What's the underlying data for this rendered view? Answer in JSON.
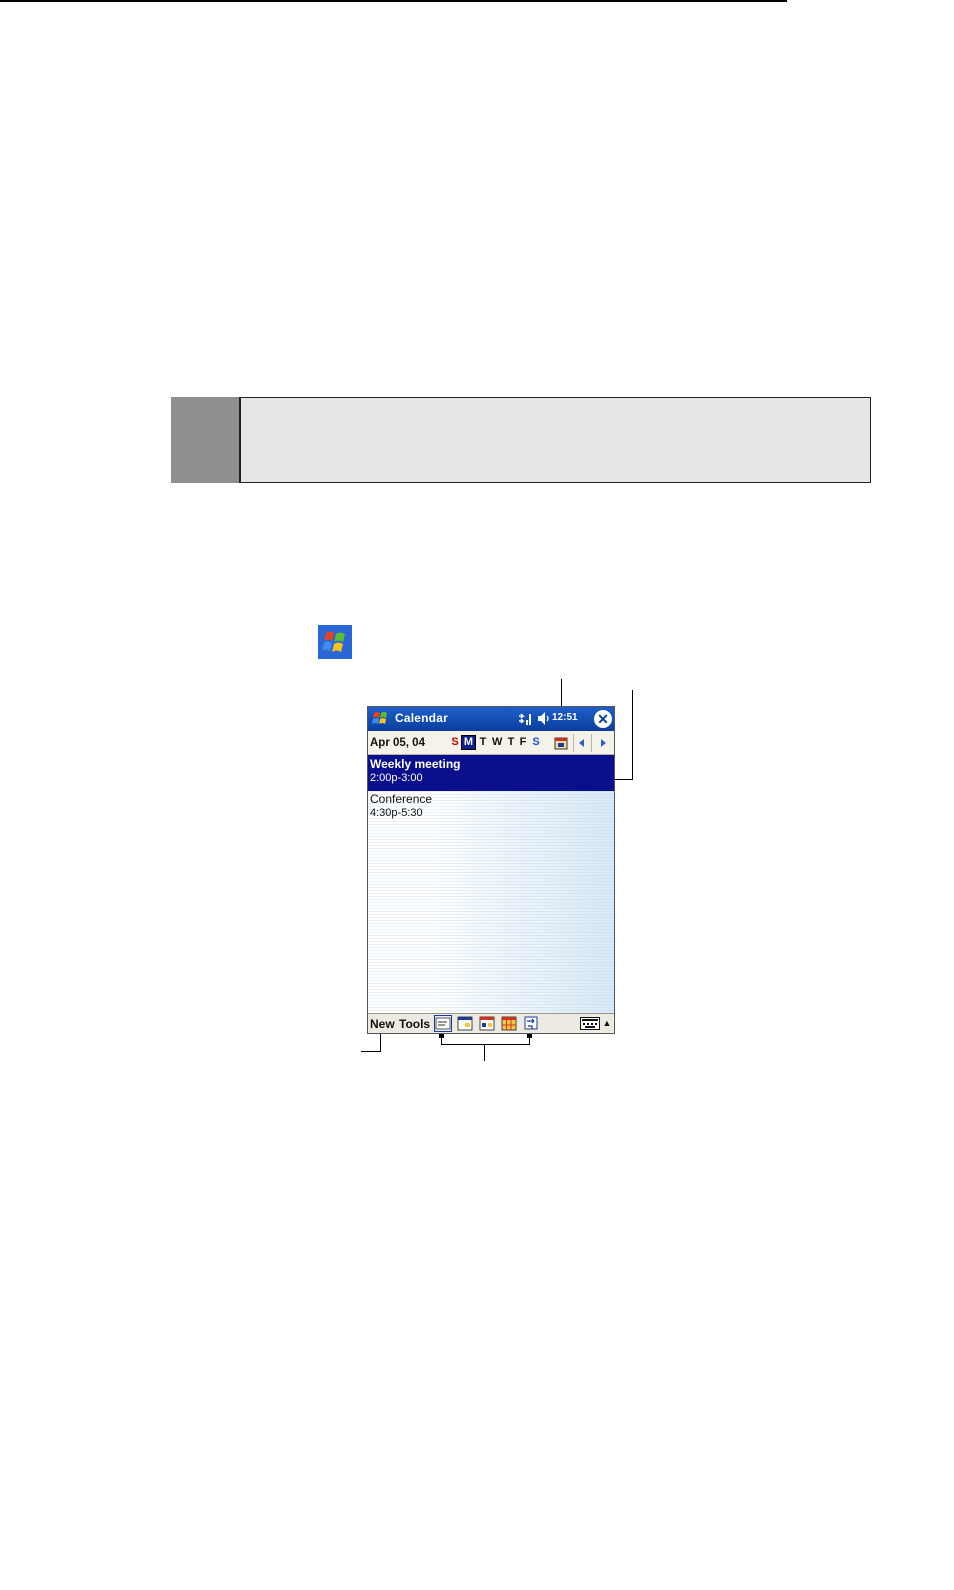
{
  "app": {
    "title": "Calendar",
    "clock": "12:51",
    "date": "Apr 05, 04"
  },
  "week_days": [
    {
      "label": "S",
      "color": "#cc0000"
    },
    {
      "label": "M",
      "selected": true
    },
    {
      "label": "T"
    },
    {
      "label": "W"
    },
    {
      "label": "T"
    },
    {
      "label": "F"
    },
    {
      "label": "S",
      "color": "#1e4fd0"
    }
  ],
  "appointments": [
    {
      "title": "Weekly meeting",
      "time": "2:00p-3:00",
      "selected": true
    },
    {
      "title": "Conference",
      "time": "4:30p-5:30"
    }
  ],
  "menu": {
    "new_label": "New",
    "tools_label": "Tools"
  },
  "icons": {
    "start": "windows-flag-icon",
    "signal": "signal-icon",
    "volume": "volume-icon",
    "close": "close-icon",
    "goto_today": "goto-today-icon",
    "prev": "prev-arrow-icon",
    "next": "next-arrow-icon",
    "views": [
      "agenda-view-icon",
      "day-view-icon",
      "week-view-icon",
      "month-view-icon",
      "year-view-icon"
    ],
    "keyboard": "keyboard-icon"
  },
  "colors": {
    "titlebar": "#1d5fc9",
    "selection": "#0a0f8c",
    "note_box": "#e6e6e6",
    "note_box_side": "#8f8f8f"
  }
}
